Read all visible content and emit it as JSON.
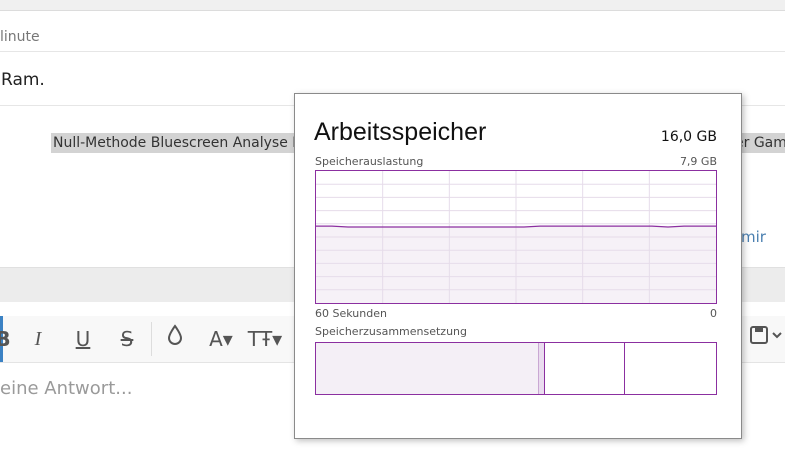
{
  "background": {
    "minute_text": "linute",
    "ram_text": "Ram.",
    "tags_text": "Null-Methode Bluescreen Analyse M",
    "tags_right_text": "er Gam",
    "link_text": "mir",
    "reply_placeholder": "eine Antwort..."
  },
  "toolbar": {
    "bold_label": "B",
    "italic_label": "I",
    "underline_label": "U",
    "strike_label": "S",
    "ink_icon": "ink-drop-icon",
    "font_color_label": "A▾",
    "font_size_label": "TŦ▾",
    "save_icon": "save-icon"
  },
  "popup": {
    "title": "Arbeitsspeicher",
    "total": "16,0 GB",
    "usage_label": "Speicherauslastung",
    "usage_max": "7,9 GB",
    "time_left": "60 Sekunden",
    "time_right": "0",
    "composition_label": "Speicherzusammensetzung",
    "accent_color": "#8b2fa0",
    "fill_color": "#f4eff6"
  },
  "chart_data": {
    "type": "area",
    "title": "Speicherauslastung",
    "xlabel": "",
    "ylabel": "",
    "x_range": [
      60,
      0
    ],
    "ylim": [
      0,
      7.9
    ],
    "series": [
      {
        "values": [
          4.6,
          4.6,
          4.55,
          4.55,
          4.55,
          4.55,
          4.55,
          4.55,
          4.55,
          4.55,
          4.55,
          4.55,
          4.55,
          4.55,
          4.6,
          4.6,
          4.6,
          4.6,
          4.6,
          4.6,
          4.6,
          4.6,
          4.55,
          4.6,
          4.6,
          4.6
        ]
      }
    ],
    "composition": {
      "used_fraction": 0.555,
      "modified_fraction": 0.015,
      "standby_fraction": 0.2,
      "free_fraction": 0.23
    }
  }
}
